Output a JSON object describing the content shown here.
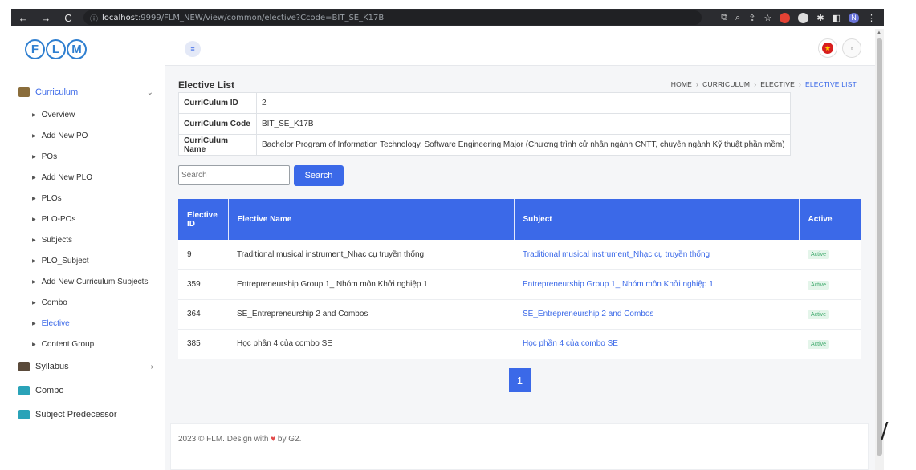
{
  "browser": {
    "url_host": "localhost",
    "url_rest": ":9999/FLM_NEW/view/common/elective?Ccode=BIT_SE_K17B",
    "profile_initial": "N"
  },
  "logo": {
    "letters": [
      "F",
      "L",
      "M"
    ]
  },
  "sidebar": {
    "curriculum_label": "Curriculum",
    "sub_items": [
      "Overview",
      "Add New PO",
      "POs",
      "Add New PLO",
      "PLOs",
      "PLO-POs",
      "Subjects",
      "PLO_Subject",
      "Add New Curriculum Subjects",
      "Combo",
      "Elective",
      "Content Group"
    ],
    "active_item": "Elective",
    "syllabus_label": "Syllabus",
    "combo_label": "Combo",
    "predecessor_label": "Subject Predecessor"
  },
  "page": {
    "title": "Elective List",
    "breadcrumb": [
      "HOME",
      "CURRICULUM",
      "ELECTIVE",
      "ELECTIVE LIST"
    ]
  },
  "info": {
    "rows": [
      {
        "key": "CurriCulum ID",
        "value": "2"
      },
      {
        "key": "CurriCulum Code",
        "value": "BIT_SE_K17B"
      },
      {
        "key": "CurriCulum Name",
        "value": "Bachelor Program of Information Technology, Software Engineering Major (Chương trình cử nhân ngành CNTT, chuyên ngành Kỹ thuật phần mềm)"
      }
    ]
  },
  "search": {
    "placeholder": "Search",
    "button_label": "Search"
  },
  "table": {
    "headers": [
      "Elective ID",
      "Elective Name",
      "Subject",
      "Active"
    ],
    "rows": [
      {
        "id": "9",
        "name": "Traditional musical instrument_Nhạc cụ truyền thống",
        "subject": "Traditional musical instrument_Nhạc cụ truyền thống",
        "status": "Active"
      },
      {
        "id": "359",
        "name": "Entrepreneurship Group 1_ Nhóm môn Khởi nghiệp 1",
        "subject": "Entrepreneurship Group 1_ Nhóm môn Khởi nghiệp 1",
        "status": "Active"
      },
      {
        "id": "364",
        "name": "SE_Entrepreneurship 2 and Combos",
        "subject": "SE_Entrepreneurship 2 and Combos",
        "status": "Active"
      },
      {
        "id": "385",
        "name": "Học phần 4 của combo SE",
        "subject": "Học phần 4 của combo SE",
        "status": "Active"
      }
    ]
  },
  "pagination": {
    "current": "1"
  },
  "footer": {
    "text_before": "2023 © FLM. Design with",
    "text_after": "by G2."
  },
  "colors": {
    "accent": "#3b69e8",
    "active_badge": "#3fa96c"
  }
}
